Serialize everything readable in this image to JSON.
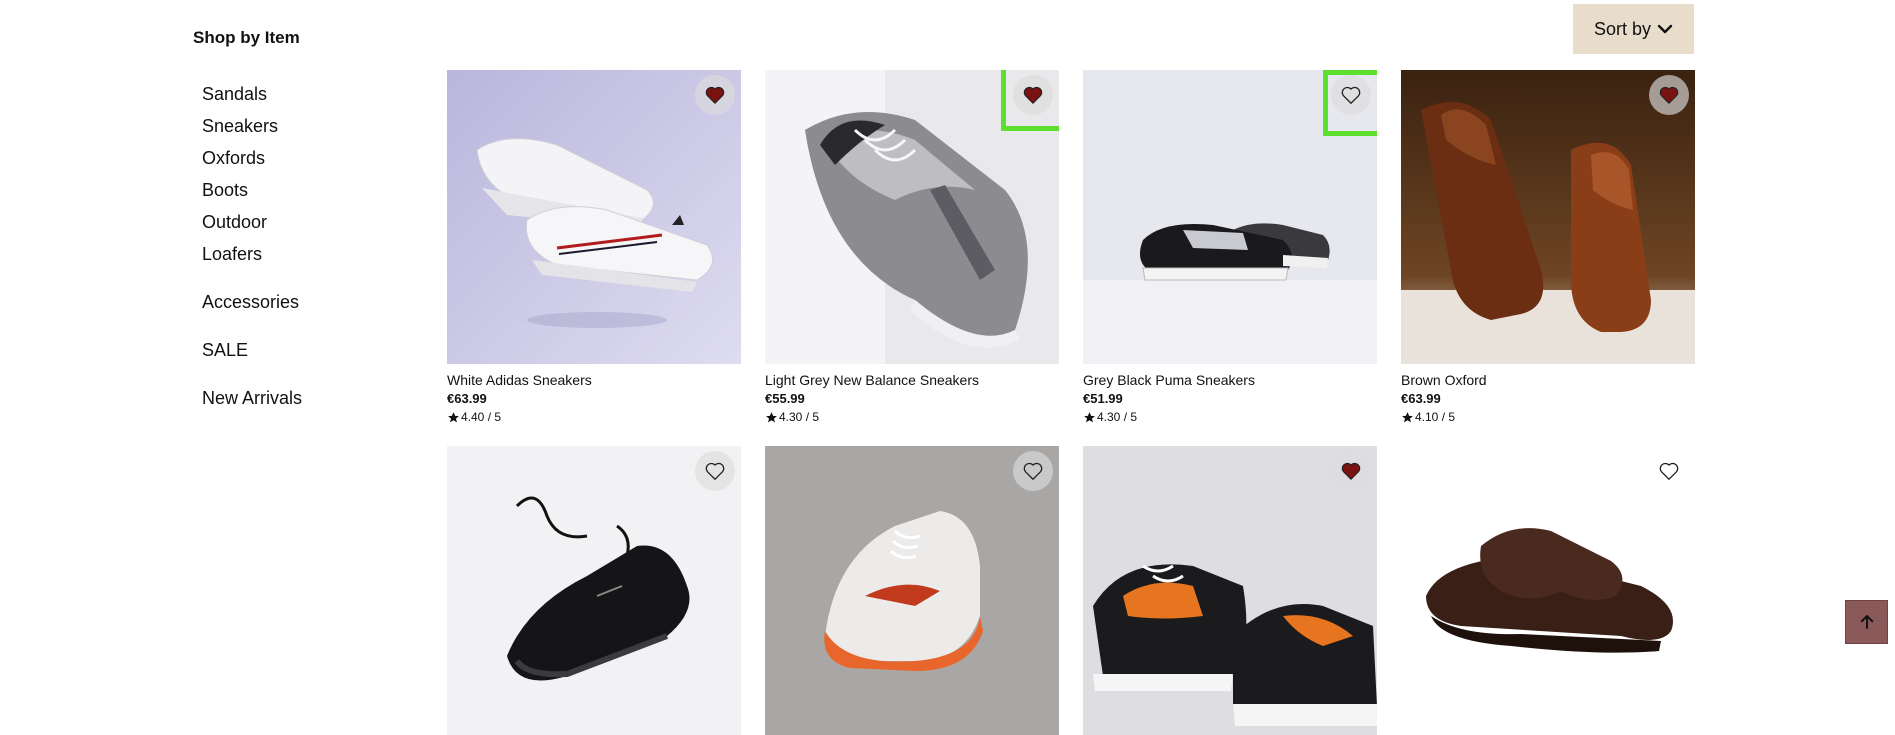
{
  "sidebar": {
    "heading": "Shop by Item",
    "categories": [
      "Sandals",
      "Sneakers",
      "Oxfords",
      "Boots",
      "Outdoor",
      "Loafers"
    ],
    "extras": [
      "Accessories",
      "SALE",
      "New Arrivals"
    ]
  },
  "sort": {
    "label": "Sort by",
    "icon": "chevron-down-icon"
  },
  "products": [
    {
      "name": "White Adidas Sneakers",
      "price": "€63.99",
      "rating": "4.40 / 5",
      "favorited": true
    },
    {
      "name": "Light Grey New Balance Sneakers",
      "price": "€55.99",
      "rating": "4.30 / 5",
      "favorited": true
    },
    {
      "name": "Grey Black Puma Sneakers",
      "price": "€51.99",
      "rating": "4.30 / 5",
      "favorited": false
    },
    {
      "name": "Brown Oxford",
      "price": "€63.99",
      "rating": "4.10 / 5",
      "favorited": true
    },
    {
      "favorited": false
    },
    {
      "favorited": false
    },
    {
      "favorited": true
    },
    {
      "favorited": false
    }
  ],
  "colors": {
    "heart_filled": "#7a1212",
    "sort_bg": "#e8dccb",
    "highlight": "#5de02d",
    "to_top_bg": "#8a5a5a"
  },
  "back_to_top": {
    "icon": "arrow-up-icon"
  }
}
